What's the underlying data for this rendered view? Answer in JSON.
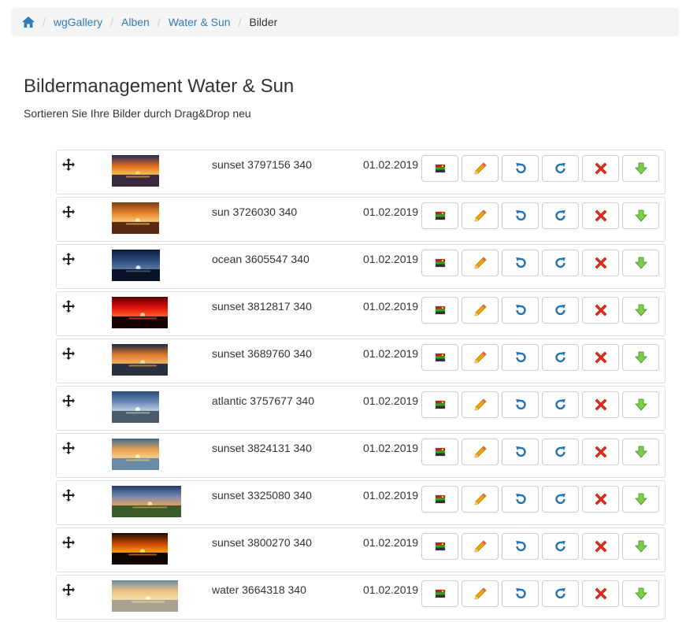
{
  "breadcrumb": {
    "home_icon": "home-icon",
    "items": [
      "wgGallery",
      "Alben",
      "Water & Sun"
    ],
    "active": "Bilder"
  },
  "page": {
    "title": "Bildermanagement Water & Sun",
    "subtitle": "Sortieren Sie Ihre Bilder durch Drag&Drop neu"
  },
  "action_icons": [
    "image-icon",
    "pencil-icon",
    "rotate-left-icon",
    "rotate-right-icon",
    "delete-icon",
    "download-icon"
  ],
  "colors": {
    "link": "#337ab7",
    "edit": "#f0a30a",
    "rotate": "#1f73b7",
    "delete": "#e52d1a",
    "download": "#5cb85c"
  },
  "images": [
    {
      "name": "sunset 3797156 340",
      "date": "01.02.2019"
    },
    {
      "name": "sun 3726030 340",
      "date": "01.02.2019"
    },
    {
      "name": "ocean 3605547 340",
      "date": "01.02.2019"
    },
    {
      "name": "sunset 3812817 340",
      "date": "01.02.2019"
    },
    {
      "name": "sunset 3689760 340",
      "date": "01.02.2019"
    },
    {
      "name": "atlantic 3757677 340",
      "date": "01.02.2019"
    },
    {
      "name": "sunset 3824131 340",
      "date": "01.02.2019"
    },
    {
      "name": "sunset 3325080 340",
      "date": "01.02.2019"
    },
    {
      "name": "sunset 3800270 340",
      "date": "01.02.2019"
    },
    {
      "name": "water 3664318 340",
      "date": "01.02.2019"
    }
  ]
}
